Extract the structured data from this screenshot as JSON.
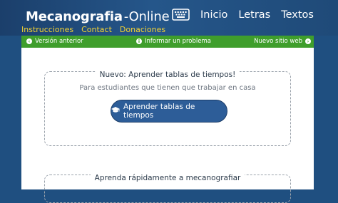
{
  "header": {
    "logo_part1": "Mecanografia",
    "logo_part2": "-Online",
    "nav": [
      "Inicio",
      "Letras",
      "Textos"
    ],
    "subnav": [
      "Instrucciones",
      "Contact",
      "Donaciones"
    ]
  },
  "greenbar": {
    "left": "Versión anterior",
    "middle": "Informar un problema",
    "right": "Nuevo sitio web"
  },
  "card1": {
    "title": "Nuevo: Aprender tablas de tiempos!",
    "subtitle": "Para estudiantes que tienen que trabajar en casa",
    "button_label": "Aprender tablas de tiempos"
  },
  "card2": {
    "title": "Aprenda rápidamente a mecanografiar"
  },
  "colors": {
    "header_bg": "#1f4f80",
    "subnav_link": "#f3d233",
    "greenbar_bg": "#3f9e2c",
    "button_bg": "#2d5d98"
  },
  "icons": {
    "logo": "keyboard-icon",
    "greenbar_left": "chevron-left-circle-icon",
    "greenbar_middle": "info-circle-icon",
    "greenbar_right": "chevron-right-circle-icon",
    "button": "graduation-cap-icon"
  }
}
